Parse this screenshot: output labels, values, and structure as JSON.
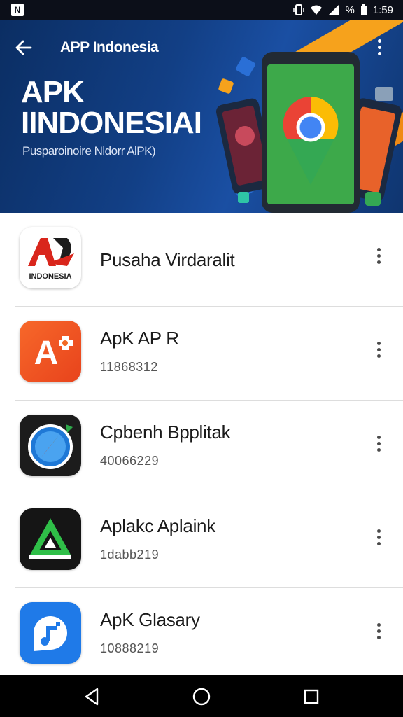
{
  "status_bar": {
    "battery_percent": "%",
    "time": "1:59"
  },
  "header": {
    "title": "APP Indonesia",
    "hero_title_line1": "APK",
    "hero_title_line2": "IINDONESIAI",
    "hero_subtitle": "Pusparoinoire Nldorr AlPK)"
  },
  "apps": [
    {
      "name": "Pusaha Virdaralit",
      "subtitle": "",
      "icon": "apk-indonesia-logo-icon",
      "icon_text": "INDONESIA"
    },
    {
      "name": "ApK AP R",
      "subtitle": "11868312",
      "icon": "orange-a-icon",
      "icon_text": "A"
    },
    {
      "name": "Cpbenh Bpplitak",
      "subtitle": "40066229",
      "icon": "compass-icon"
    },
    {
      "name": "Aplakc Aplaink",
      "subtitle": "1dabb219",
      "icon": "green-triangle-icon"
    },
    {
      "name": "ApK Glasary",
      "subtitle": "10888219",
      "icon": "blue-music-icon"
    }
  ],
  "colors": {
    "header_bg": "#123f85",
    "accent_orange": "#f6a21c",
    "nav_bg": "#000000"
  }
}
